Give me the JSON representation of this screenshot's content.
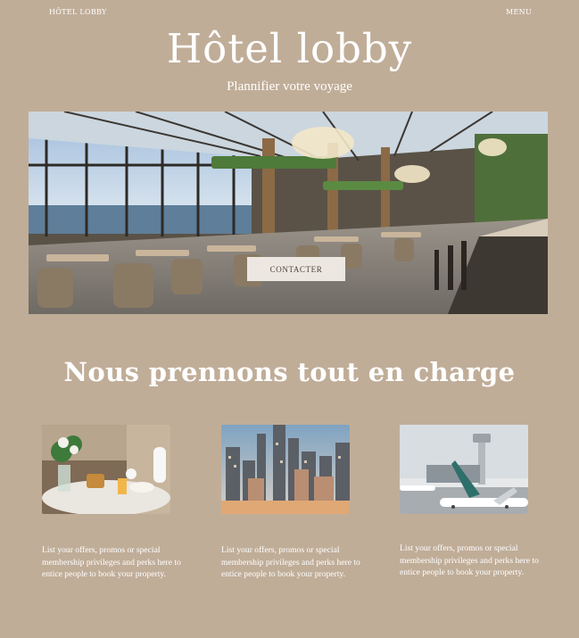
{
  "header": {
    "brand": "HÔTEL LOBBY",
    "menu_label": "MENU"
  },
  "hero": {
    "title": "Hôtel lobby",
    "subtitle": "Plannifier votre voyage",
    "cta_label": "CONTACTER"
  },
  "services": {
    "title": "Nous prennons tout en charge",
    "cards": [
      {
        "image": "breakfast-photo",
        "text": "List your offers, promos or special membership privileges and perks here to entice people to book your property."
      },
      {
        "image": "city-skyline-photo",
        "text": "List your offers, promos or special membership privileges and perks here to entice people to book your property."
      },
      {
        "image": "airport-plane-photo",
        "text": "List your offers, promos or special membership privileges and perks here to entice people to book your property."
      }
    ]
  },
  "colors": {
    "background": "#c0ad98",
    "text": "#ffffff",
    "button_bg": "#ece7e1",
    "button_text": "#4d4135"
  }
}
